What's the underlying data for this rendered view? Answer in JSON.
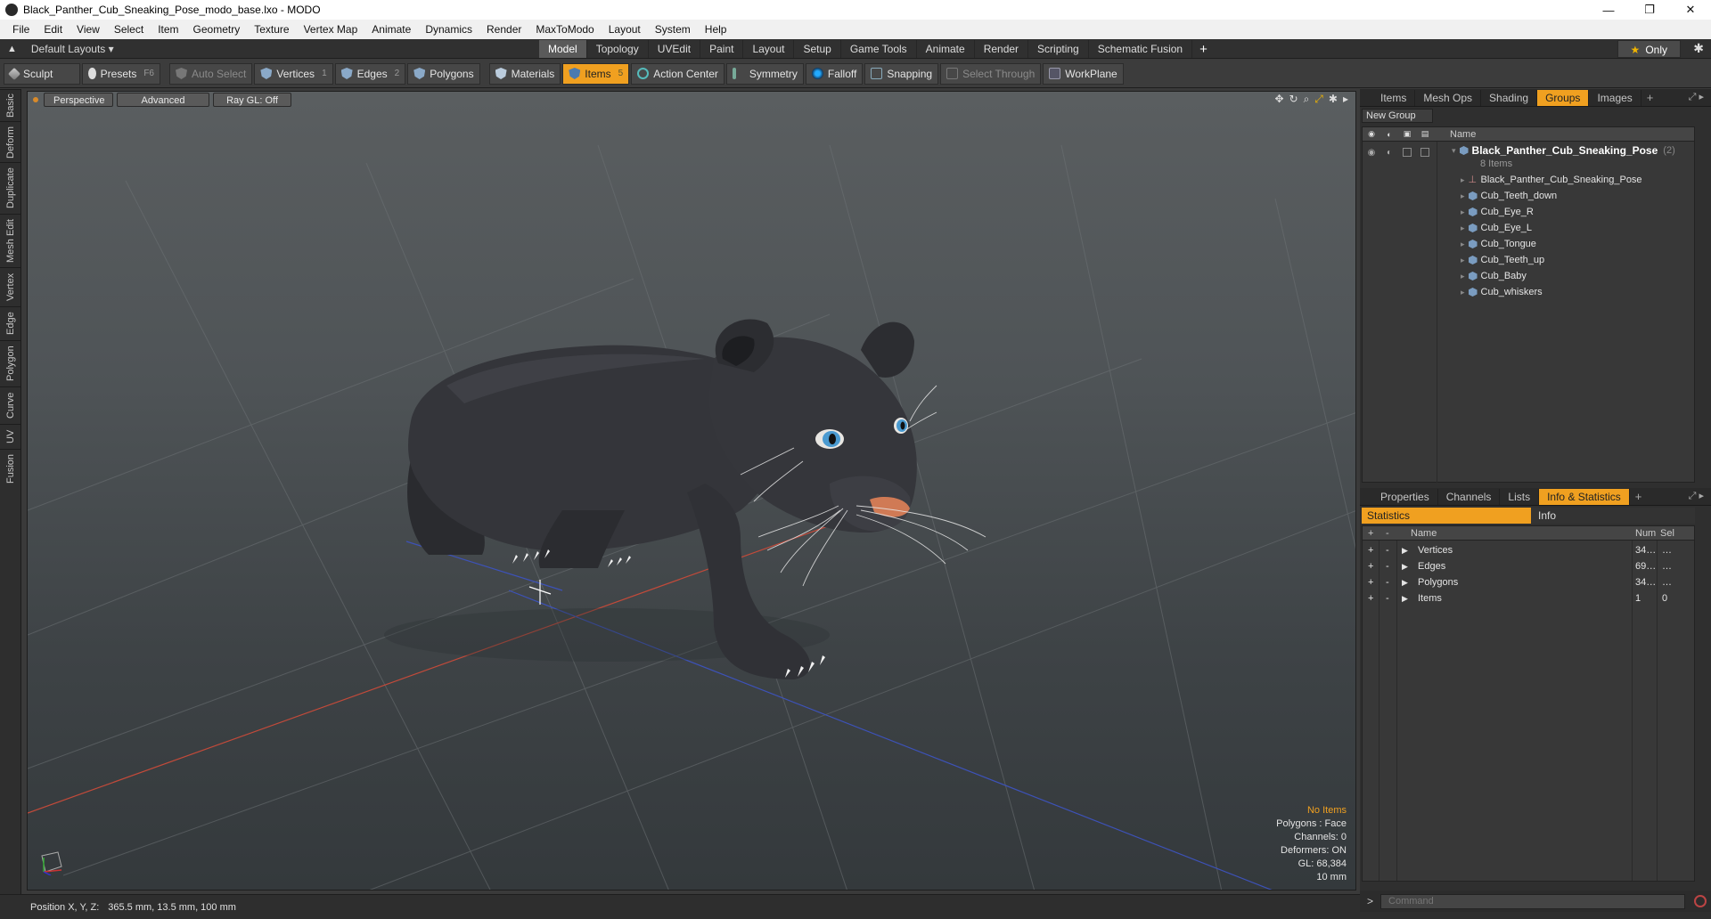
{
  "window": {
    "title": "Black_Panther_Cub_Sneaking_Pose_modo_base.lxo - MODO",
    "controls": [
      "—",
      "❐",
      "✕"
    ]
  },
  "menu": [
    "File",
    "Edit",
    "View",
    "Select",
    "Item",
    "Geometry",
    "Texture",
    "Vertex Map",
    "Animate",
    "Dynamics",
    "Render",
    "MaxToModo",
    "Layout",
    "System",
    "Help"
  ],
  "layoutbar": {
    "layout_name": "Default Layouts ▾",
    "tabs": [
      "Model",
      "Topology",
      "UVEdit",
      "Paint",
      "Layout",
      "Setup",
      "Game Tools",
      "Animate",
      "Render",
      "Scripting",
      "Schematic Fusion"
    ],
    "active_tab": "Model",
    "only_label": "Only",
    "plus": "+"
  },
  "toolbar": {
    "sculpt": "Sculpt",
    "presets": "Presets",
    "presets_key": "F6",
    "auto_select": "Auto Select",
    "vertices": "Vertices",
    "vertices_key": "1",
    "edges": "Edges",
    "edges_key": "2",
    "polygons": "Polygons",
    "materials": "Materials",
    "items": "Items",
    "items_key": "5",
    "action_center": "Action Center",
    "symmetry": "Symmetry",
    "falloff": "Falloff",
    "snapping": "Snapping",
    "select_through": "Select Through",
    "workplane": "WorkPlane"
  },
  "left_tabs": [
    "Basic",
    "Deform",
    "Duplicate",
    "Mesh Edit",
    "Vertex",
    "Edge",
    "Polygon",
    "Curve",
    "UV",
    "Fusion"
  ],
  "viewport": {
    "view_mode": "Perspective",
    "advanced": "Advanced",
    "raygl": "Ray GL: Off",
    "info": {
      "no_items": "No Items",
      "polygons": "Polygons : Face",
      "channels": "Channels: 0",
      "deformers": "Deformers: ON",
      "gl": "GL: 68,384",
      "scale": "10 mm"
    }
  },
  "status": {
    "position_label": "Position X, Y, Z:",
    "position_value": "365.5 mm, 13.5 mm, 100 mm"
  },
  "groups_panel": {
    "tabs": [
      "Items",
      "Mesh Ops",
      "Shading",
      "Groups",
      "Images"
    ],
    "active_tab": "Groups",
    "new_group": "New Group",
    "name_header": "Name",
    "root": {
      "name": "Black_Panther_Cub_Sneaking_Pose",
      "count": "(2)",
      "sub": "8 Items"
    },
    "children": [
      {
        "name": "Black_Panther_Cub_Sneaking_Pose",
        "icon": "locator-icon"
      },
      {
        "name": "Cub_Teeth_down",
        "icon": "mesh-icon"
      },
      {
        "name": "Cub_Eye_R",
        "icon": "mesh-icon"
      },
      {
        "name": "Cub_Eye_L",
        "icon": "mesh-icon"
      },
      {
        "name": "Cub_Tongue",
        "icon": "mesh-icon"
      },
      {
        "name": "Cub_Teeth_up",
        "icon": "mesh-icon"
      },
      {
        "name": "Cub_Baby",
        "icon": "mesh-icon"
      },
      {
        "name": "Cub_whiskers",
        "icon": "mesh-icon"
      }
    ]
  },
  "stats_panel": {
    "tabs": [
      "Properties",
      "Channels",
      "Lists",
      "Info & Statistics"
    ],
    "active_tab": "Info & Statistics",
    "sub_tabs": [
      "Statistics",
      "Info"
    ],
    "headers": {
      "name": "Name",
      "num": "Num",
      "sel": "Sel"
    },
    "rows": [
      {
        "name": "Vertices",
        "num": "34…",
        "sel": "…"
      },
      {
        "name": "Edges",
        "num": "69…",
        "sel": "…"
      },
      {
        "name": "Polygons",
        "num": "34…",
        "sel": "…"
      },
      {
        "name": "Items",
        "num": "1",
        "sel": "0"
      }
    ]
  },
  "command": {
    "prompt": ">",
    "placeholder": "Command"
  },
  "colors": {
    "accent": "#f0a020",
    "viewport_bg": "#4f5457",
    "panther_fur": "#2e2e32",
    "eye": "#4a9ad0"
  }
}
